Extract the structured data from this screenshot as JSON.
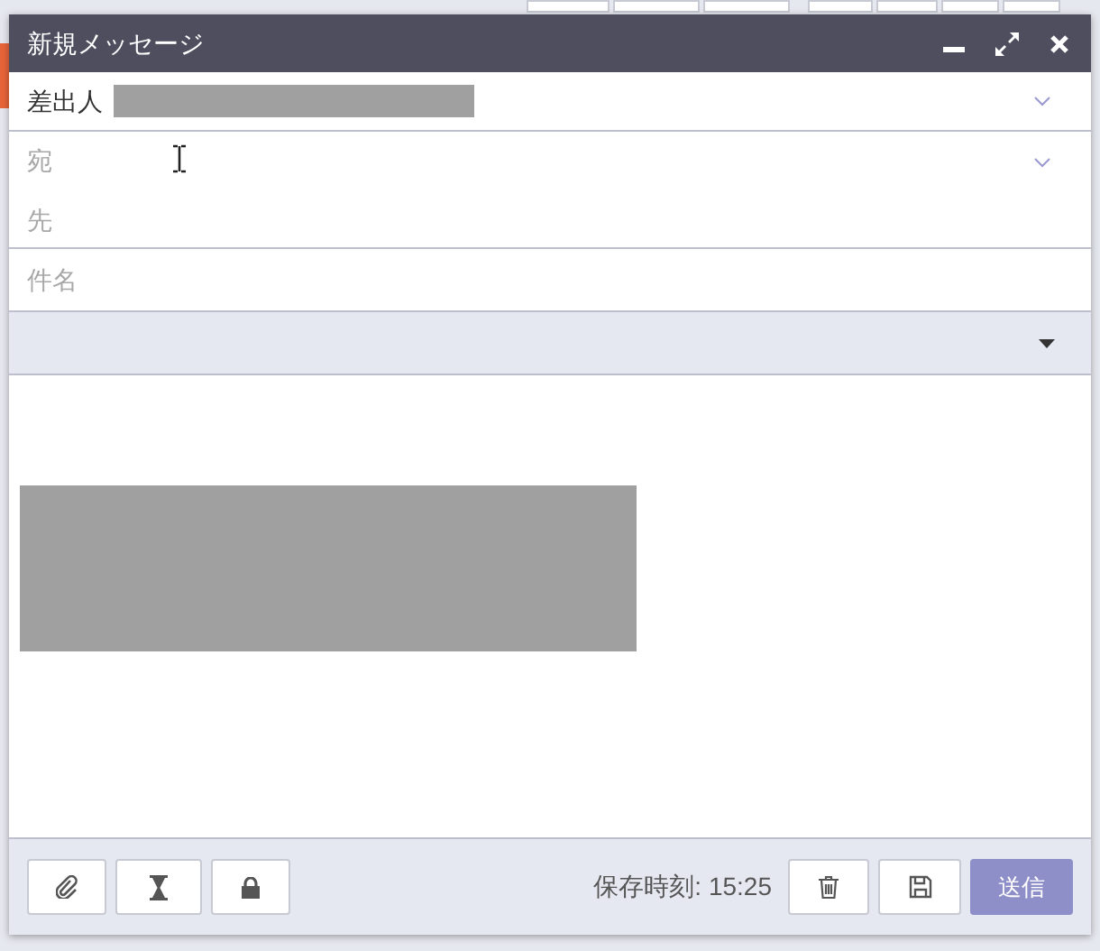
{
  "window": {
    "title": "新規メッセージ"
  },
  "from": {
    "label": "差出人"
  },
  "to": {
    "placeholder": "宛先"
  },
  "subject": {
    "placeholder": "件名"
  },
  "footer": {
    "saved_time": "保存時刻: 15:25",
    "send": "送信"
  }
}
